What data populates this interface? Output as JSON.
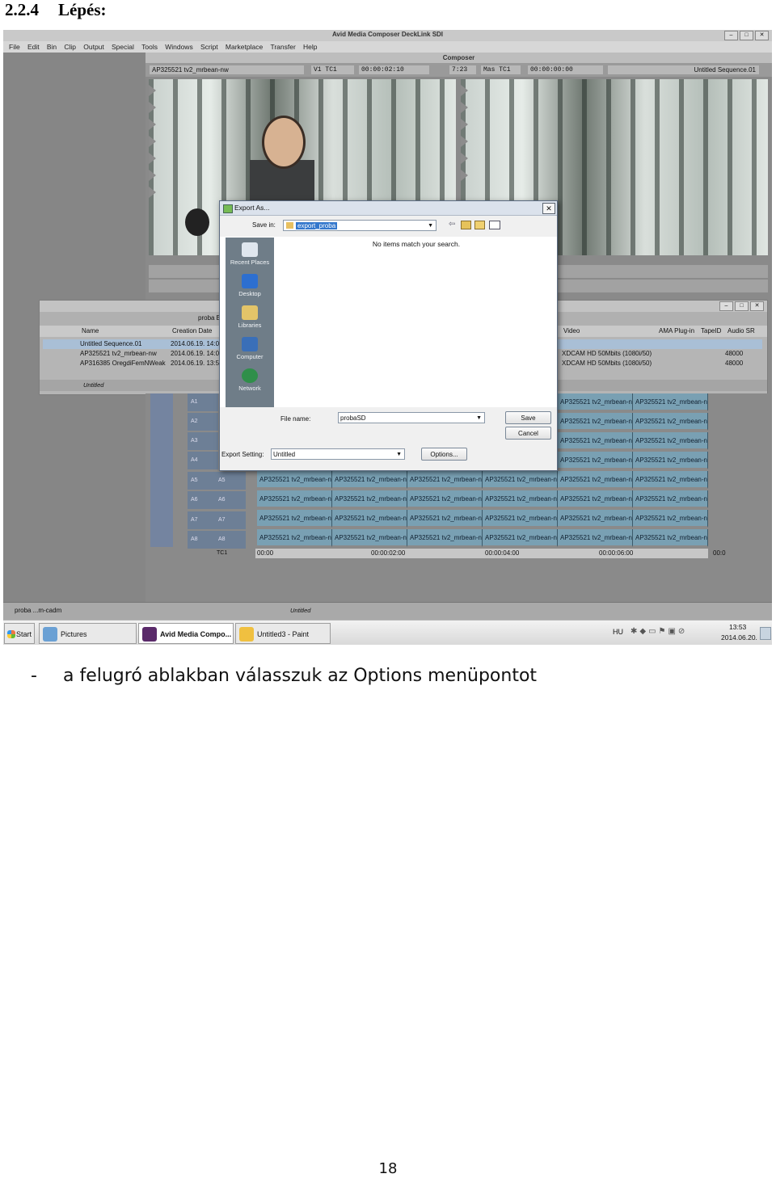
{
  "heading": {
    "number": "2.2.4",
    "title": "Lépés:"
  },
  "app": {
    "title": "Avid Media Composer DeckLink SDI",
    "menu": [
      "File",
      "Edit",
      "Bin",
      "Clip",
      "Output",
      "Special",
      "Tools",
      "Windows",
      "Script",
      "Marketplace",
      "Transfer",
      "Help"
    ],
    "composer": {
      "title": "Composer",
      "source_clip": "AP325521 tv2_mrbean-nw",
      "v1_label": "V1 TC1",
      "v1_tc": "00:00:02:10",
      "duration": "7:23",
      "mas_label": "Mas TC1",
      "mas_tc": "00:00:00:00",
      "sequence": "Untitled Sequence.01"
    },
    "bin": {
      "title": "proba Bin",
      "columns": [
        "Name",
        "Creation Date"
      ],
      "rows": [
        {
          "name": "Untitled Sequence.01",
          "date": "2014.06.19. 14:0"
        },
        {
          "name": "AP325521 tv2_mrbean-nw",
          "date": "2014.06.19. 14:0"
        },
        {
          "name": "AP316385 OregdiFemNWeak",
          "date": "2014.06.19. 13:5"
        }
      ],
      "right_columns": [
        "Video",
        "AMA Plug-in",
        "TapeID",
        "Audio SR"
      ],
      "right_rows": [
        {
          "video": "XDCAM HD 50Mbits (1080i/50)",
          "sr": "48000"
        },
        {
          "video": "XDCAM HD 50Mbits (1080i/50)",
          "sr": "48000"
        }
      ],
      "footer_label": "Untitled"
    },
    "timeline": {
      "tracks": [
        "A1",
        "A2",
        "A3",
        "A4",
        "A5",
        "A6",
        "A7",
        "A8"
      ],
      "tracks_right": [
        "A5",
        "A6",
        "A7",
        "A8"
      ],
      "tc_label": "TC1",
      "clip_label": "AP325521 tv2_mrbean-n",
      "ruler": [
        "00:00",
        "00:00:02:00",
        "00:00:04:00",
        "00:00:06:00",
        "00:0"
      ],
      "footer_label": "Untitled",
      "project_label": "proba ...m-cadm"
    }
  },
  "dialog": {
    "title": "Export As...",
    "save_in_label": "Save in:",
    "save_in_value": "export_proba",
    "empty_message": "No items match your search.",
    "places": [
      "Recent Places",
      "Desktop",
      "Libraries",
      "Computer",
      "Network"
    ],
    "file_name_label": "File name:",
    "file_name_value": "probaSD",
    "export_setting_label": "Export Setting:",
    "export_setting_value": "Untitled",
    "save_button": "Save",
    "cancel_button": "Cancel",
    "options_button": "Options..."
  },
  "taskbar": {
    "start": "Start",
    "tasks": [
      "Pictures",
      "Avid Media Compo...",
      "Untitled3 - Paint"
    ],
    "lang": "HU",
    "time": "13:53",
    "date": "2014.06.20."
  },
  "caption": {
    "dash": "-",
    "text": "a felugró ablakban válasszuk az Options menüpontot"
  },
  "page_number": "18"
}
